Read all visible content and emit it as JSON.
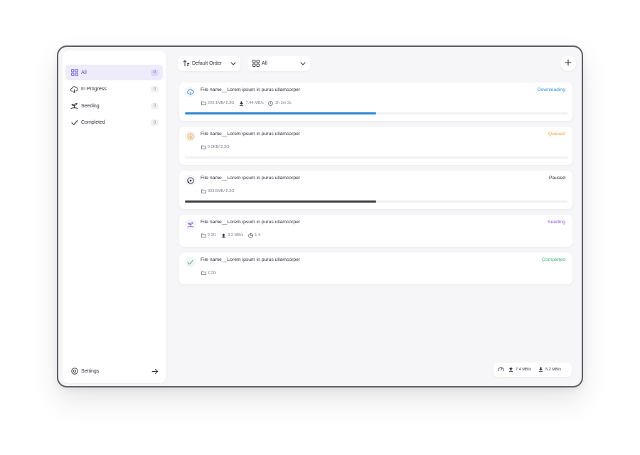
{
  "sidebar": {
    "items": [
      {
        "label": "All",
        "count": "0",
        "icon": "grid-icon"
      },
      {
        "label": "In Progress",
        "count": "0",
        "icon": "cloud-download-icon"
      },
      {
        "label": "Seeding",
        "count": "0",
        "icon": "seedling-icon"
      },
      {
        "label": "Completed",
        "count": "0",
        "icon": "check-icon"
      }
    ],
    "settings_label": "Settings"
  },
  "toolbar": {
    "order_label": "Default Order",
    "filter_label": "All"
  },
  "downloads": [
    {
      "name": "File name__Lorem ipsum in purus ullamcorper",
      "status": "Downloading",
      "status_color": "#2f8fd6",
      "size": "209.1MB/ 2.3G",
      "speed": "7.44 MB/s",
      "time": "1h 3m 3s",
      "progress": 0.5,
      "bar_color": "#2f86d6"
    },
    {
      "name": "File name__Lorem ipsum in purus ullamcorper",
      "status": "Queued",
      "status_color": "#f0a431",
      "size": "0.0KB/ 2.3G",
      "progress": 0.0
    },
    {
      "name": "File name__Lorem ipsum in purus ullamcorper",
      "status": "Paused",
      "status_color": "#2a2f3a",
      "size": "903.6MB/ 2.3G",
      "progress": 0.5,
      "bar_color": "#3d3f45"
    },
    {
      "name": "File name__Lorem ipsum in purus ullamcorper",
      "status": "Seeding",
      "status_color": "#8a5cd6",
      "size": "2.3G",
      "upload": "3.3 MB/s",
      "ratio": "1.4"
    },
    {
      "name": "File name__Lorem ipsum in purus ullamcorper",
      "status": "Completed",
      "status_color": "#3cb46e",
      "size": "2.3G"
    }
  ],
  "speedbar": {
    "upload": "7.4 MB/s",
    "download": "5.2 MB/s"
  }
}
